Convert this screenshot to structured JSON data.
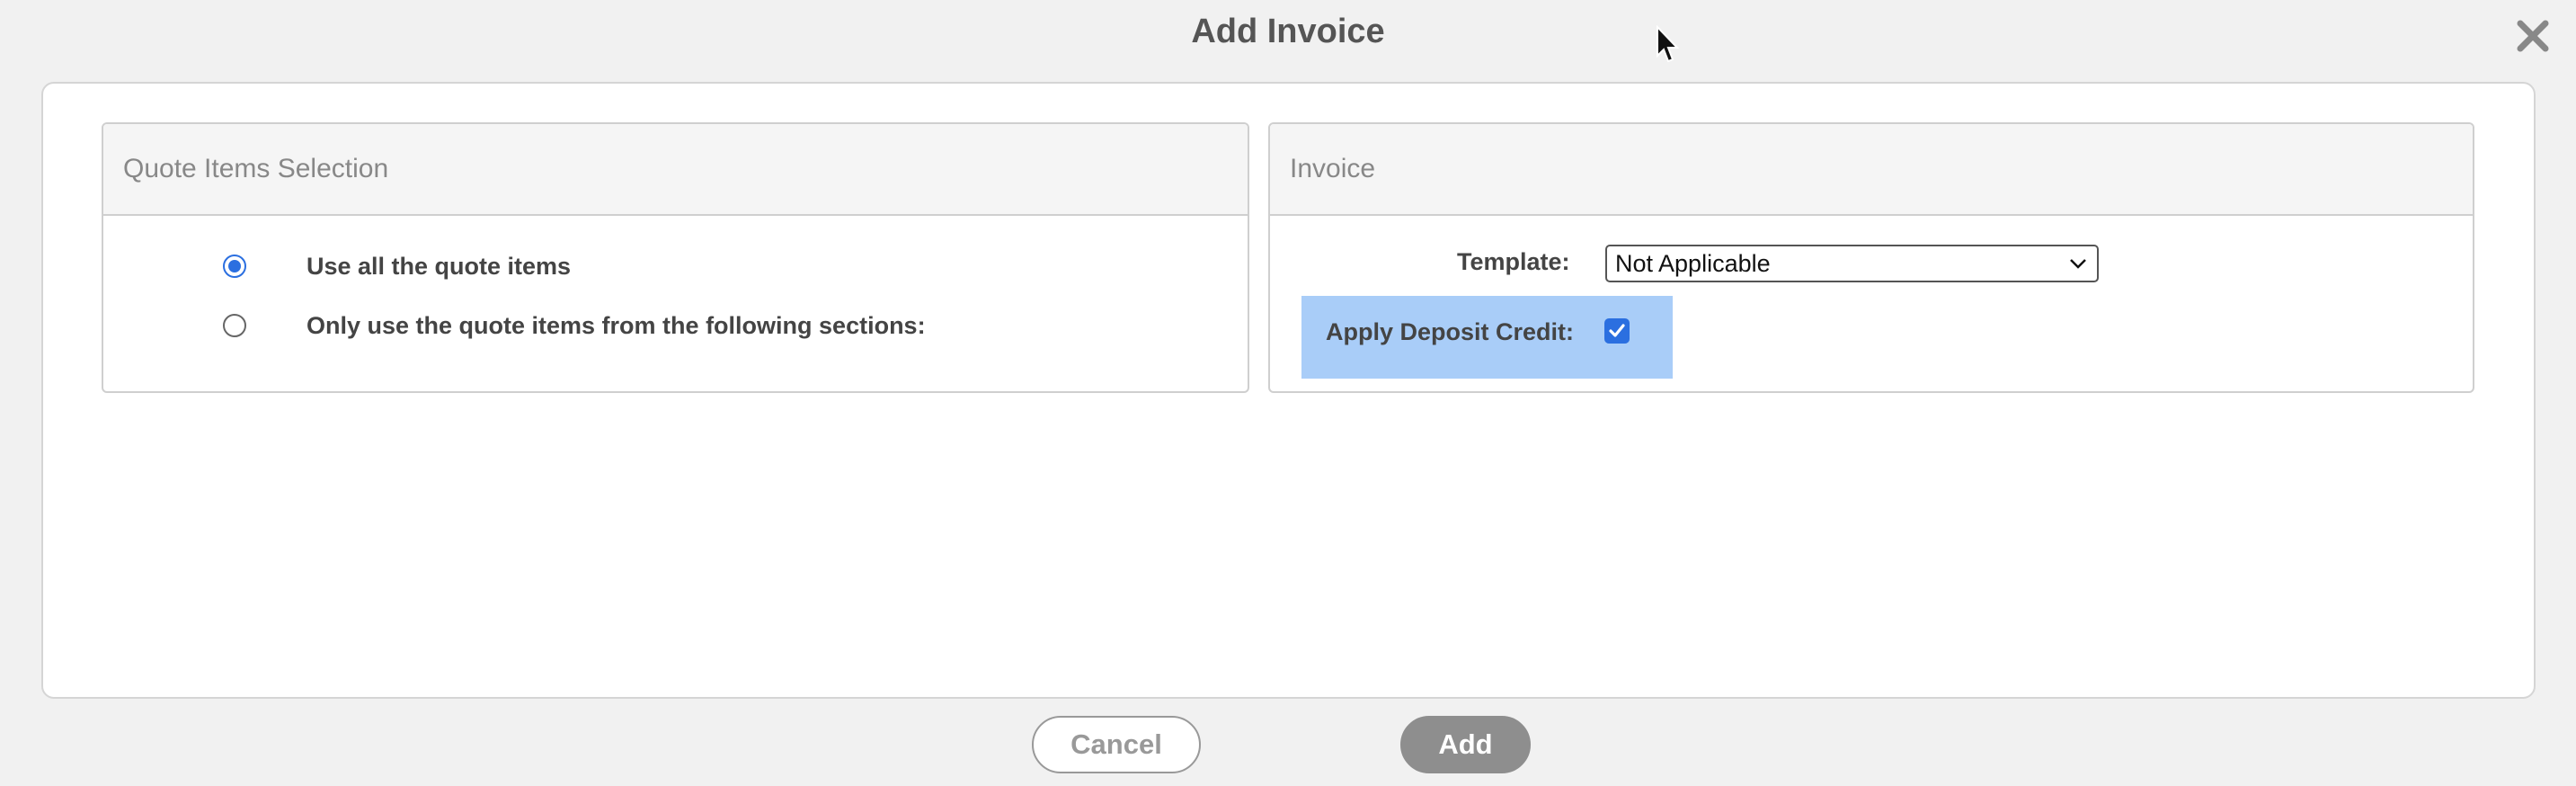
{
  "dialog": {
    "title": "Add Invoice",
    "close_icon": "close-icon"
  },
  "quote_panel": {
    "title": "Quote Items Selection",
    "options": [
      {
        "label": "Use all the quote items",
        "selected": true
      },
      {
        "label": "Only use the quote items from the following sections:",
        "selected": false
      }
    ]
  },
  "invoice_panel": {
    "title": "Invoice",
    "template_label": "Template:",
    "template_value": "Not Applicable",
    "deposit_label": "Apply Deposit Credit:",
    "deposit_checked": true
  },
  "buttons": {
    "cancel": "Cancel",
    "add": "Add"
  },
  "colors": {
    "accent": "#2b6fe0",
    "highlight": "#a9cdf8",
    "add_button": "#8e8e8e"
  }
}
